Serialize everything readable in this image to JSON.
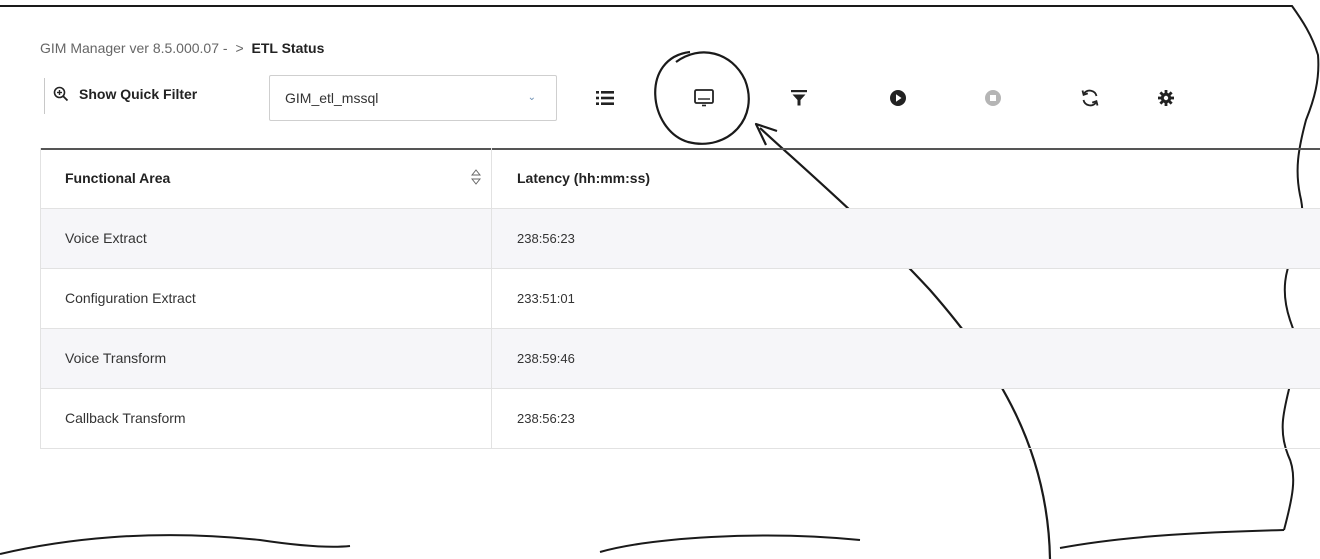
{
  "header": {
    "app_title": "GIM Manager ver 8.5.000.07 -",
    "separator": ">",
    "page_title": "ETL Status"
  },
  "toolbar": {
    "quick_filter_label": "Show Quick Filter",
    "selected_source": "GIM_etl_mssql",
    "icons": [
      "list-icon",
      "monitor-icon",
      "filter-icon",
      "play-icon",
      "stop-icon",
      "refresh-icon",
      "settings-icon"
    ]
  },
  "table": {
    "columns": [
      "Functional Area",
      "Latency (hh:mm:ss)"
    ],
    "rows": [
      {
        "area": "Voice Extract",
        "latency": "238:56:23"
      },
      {
        "area": "Configuration Extract",
        "latency": "233:51:01"
      },
      {
        "area": "Voice Transform",
        "latency": "238:59:46"
      },
      {
        "area": "Callback Transform",
        "latency": "238:56:23"
      }
    ]
  },
  "colors": {
    "accent": "#1a1a1a",
    "disabled": "#9a9a9a",
    "row_alt": "#f6f6f9"
  }
}
